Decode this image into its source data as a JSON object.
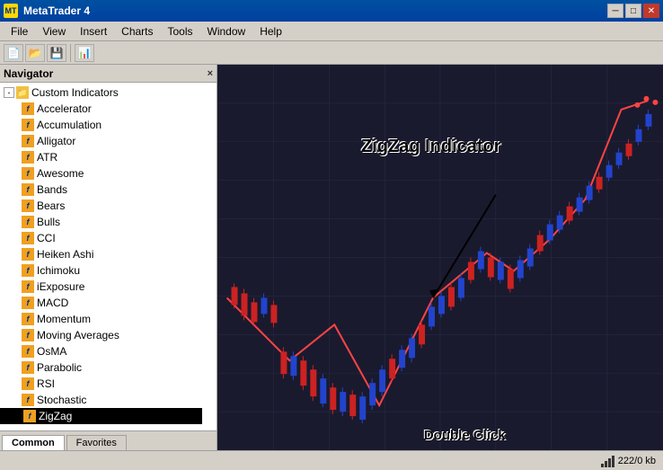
{
  "titleBar": {
    "title": "MetaTrader 4",
    "iconLabel": "MT",
    "controls": {
      "minimize": "─",
      "maximize": "□",
      "close": "✕"
    }
  },
  "menuBar": {
    "items": [
      "File",
      "View",
      "Insert",
      "Charts",
      "Tools",
      "Window",
      "Help"
    ]
  },
  "navigator": {
    "title": "Navigator",
    "closeBtn": "×",
    "tree": {
      "root": {
        "label": "Custom Indicators",
        "expanded": true,
        "icon": "folder-icon"
      },
      "items": [
        "Accelerator",
        "Accumulation",
        "Alligator",
        "ATR",
        "Awesome",
        "Bands",
        "Bears",
        "Bulls",
        "CCI",
        "Heiken Ashi",
        "Ichimoku",
        "iExposure",
        "MACD",
        "Momentum",
        "Moving Averages",
        "OsMA",
        "Parabolic",
        "RSI",
        "Stochastic",
        "ZigZag"
      ]
    },
    "tabs": [
      {
        "label": "Common",
        "active": true
      },
      {
        "label": "Favorites",
        "active": false
      }
    ]
  },
  "chart": {
    "annotation": "ZigZag Indicator",
    "doubleClick": "Double Click"
  },
  "statusBar": {
    "memory": "222/0 kb"
  }
}
